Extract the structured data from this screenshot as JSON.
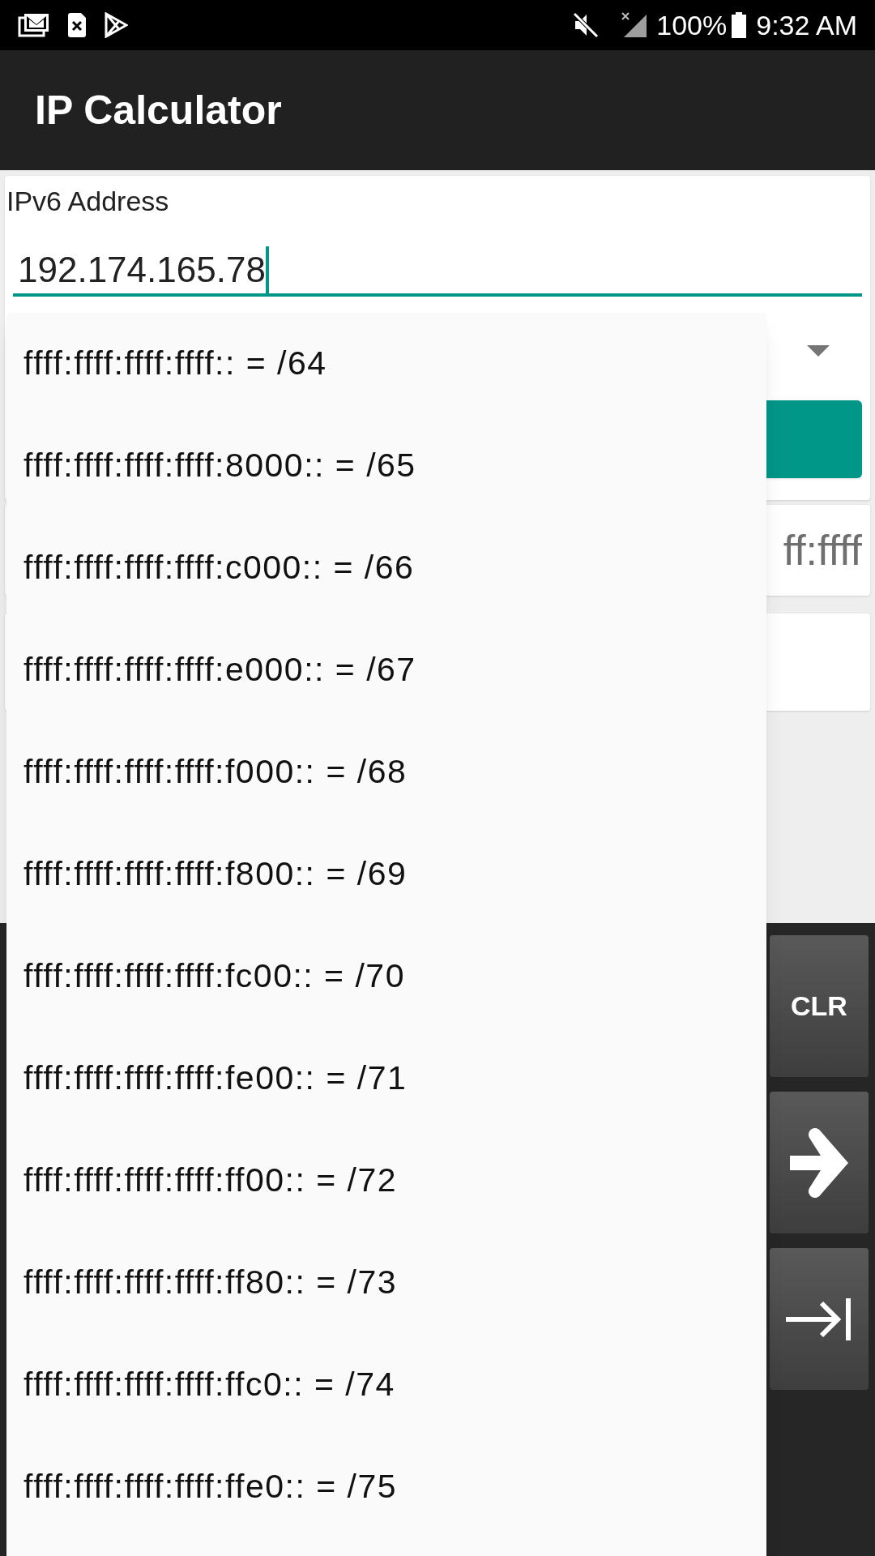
{
  "status_bar": {
    "battery": "100%",
    "time": "9:32 AM"
  },
  "app_bar": {
    "title": "IP Calculator"
  },
  "address_field": {
    "label": "IPv6 Address",
    "value": "192.174.165.78"
  },
  "result_field": {
    "value": "ff:ffff"
  },
  "dropdown": {
    "options": [
      {
        "label": "ffff:ffff:ffff:ffff:: = /64"
      },
      {
        "label": "ffff:ffff:ffff:ffff:8000:: = /65"
      },
      {
        "label": "ffff:ffff:ffff:ffff:c000:: = /66"
      },
      {
        "label": "ffff:ffff:ffff:ffff:e000:: = /67"
      },
      {
        "label": "ffff:ffff:ffff:ffff:f000:: = /68"
      },
      {
        "label": "ffff:ffff:ffff:ffff:f800:: = /69"
      },
      {
        "label": "ffff:ffff:ffff:ffff:fc00:: = /70"
      },
      {
        "label": "ffff:ffff:ffff:ffff:fe00:: = /71"
      },
      {
        "label": "ffff:ffff:ffff:ffff:ff00:: = /72"
      },
      {
        "label": "ffff:ffff:ffff:ffff:ff80:: = /73"
      },
      {
        "label": "ffff:ffff:ffff:ffff:ffc0:: = /74"
      },
      {
        "label": "ffff:ffff:ffff:ffff:ffe0:: = /75"
      }
    ]
  },
  "keypad": [
    {
      "kind": "text",
      "label": "CLR"
    },
    {
      "kind": "arrow"
    },
    {
      "kind": "tab"
    }
  ]
}
